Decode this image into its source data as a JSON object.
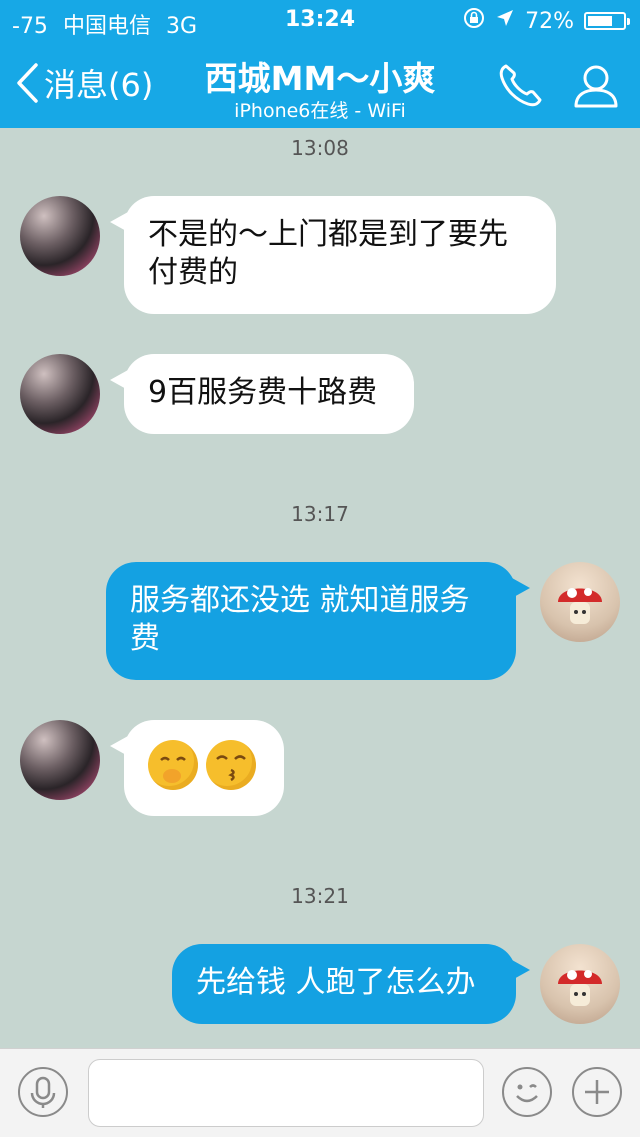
{
  "status_bar": {
    "signal": "-75",
    "carrier": "中国电信",
    "network": "3G",
    "time": "13:24",
    "battery": "72%",
    "battery_level": 0.72
  },
  "nav": {
    "back_label": "消息(6)",
    "title": "西城MM～小爽",
    "subtitle": "iPhone6在线 - WiFi"
  },
  "messages": [
    {
      "type": "timestamp",
      "text": "13:08"
    },
    {
      "type": "incoming",
      "text": "不是的～上门都是到了要先付费的"
    },
    {
      "type": "incoming",
      "text": "9百服务费十路费"
    },
    {
      "type": "timestamp",
      "text": "13:17"
    },
    {
      "type": "outgoing",
      "text": "服务都还没选 就知道服务费"
    },
    {
      "type": "incoming",
      "emojis": [
        "blush-hand-emoji",
        "kiss-emoji"
      ]
    },
    {
      "type": "timestamp",
      "text": "13:21"
    },
    {
      "type": "outgoing",
      "text": "先给钱 人跑了怎么办"
    }
  ],
  "input": {
    "value": "",
    "placeholder": ""
  },
  "colors": {
    "nav_bg": "#17a8e6",
    "chat_bg": "#c6d6d0",
    "outgoing_bubble": "#14a1e2",
    "incoming_bubble": "#ffffff"
  },
  "icons": [
    "chevron-left-icon",
    "phone-icon",
    "profile-icon",
    "microphone-icon",
    "smiley-icon",
    "plus-icon",
    "lock-rotation-icon",
    "location-arrow-icon",
    "battery-icon"
  ]
}
